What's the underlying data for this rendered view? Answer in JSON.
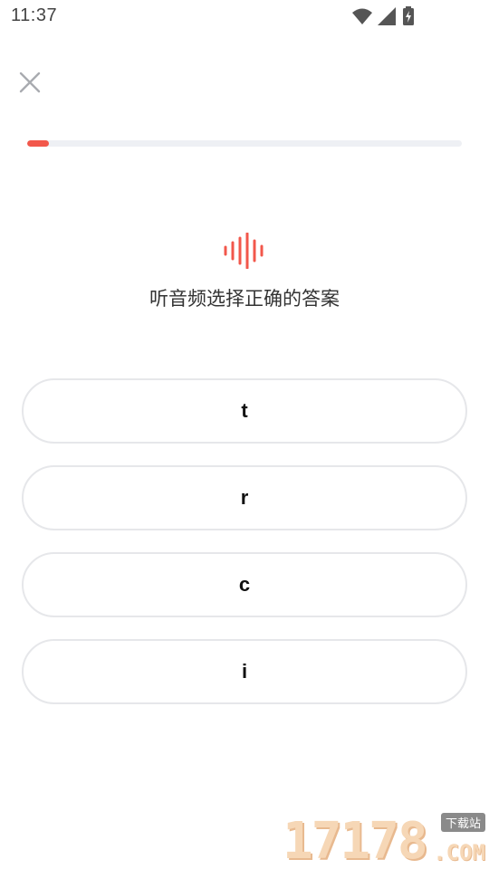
{
  "status_bar": {
    "time": "11:37",
    "icons": [
      "wifi-icon",
      "cellular-signal-icon",
      "battery-charging-icon"
    ]
  },
  "header": {
    "close_icon": "close-icon"
  },
  "progress": {
    "fraction": 0.05,
    "color": "#f2574b"
  },
  "question": {
    "audio_icon": "sound-wave-icon",
    "audio_icon_color": "#f2574b",
    "prompt": "听音频选择正确的答案"
  },
  "options": [
    {
      "label": "t"
    },
    {
      "label": "r"
    },
    {
      "label": "c"
    },
    {
      "label": "i"
    }
  ],
  "watermark": {
    "number": "17178",
    "dotcom": ".COM",
    "badge": "下载站"
  }
}
